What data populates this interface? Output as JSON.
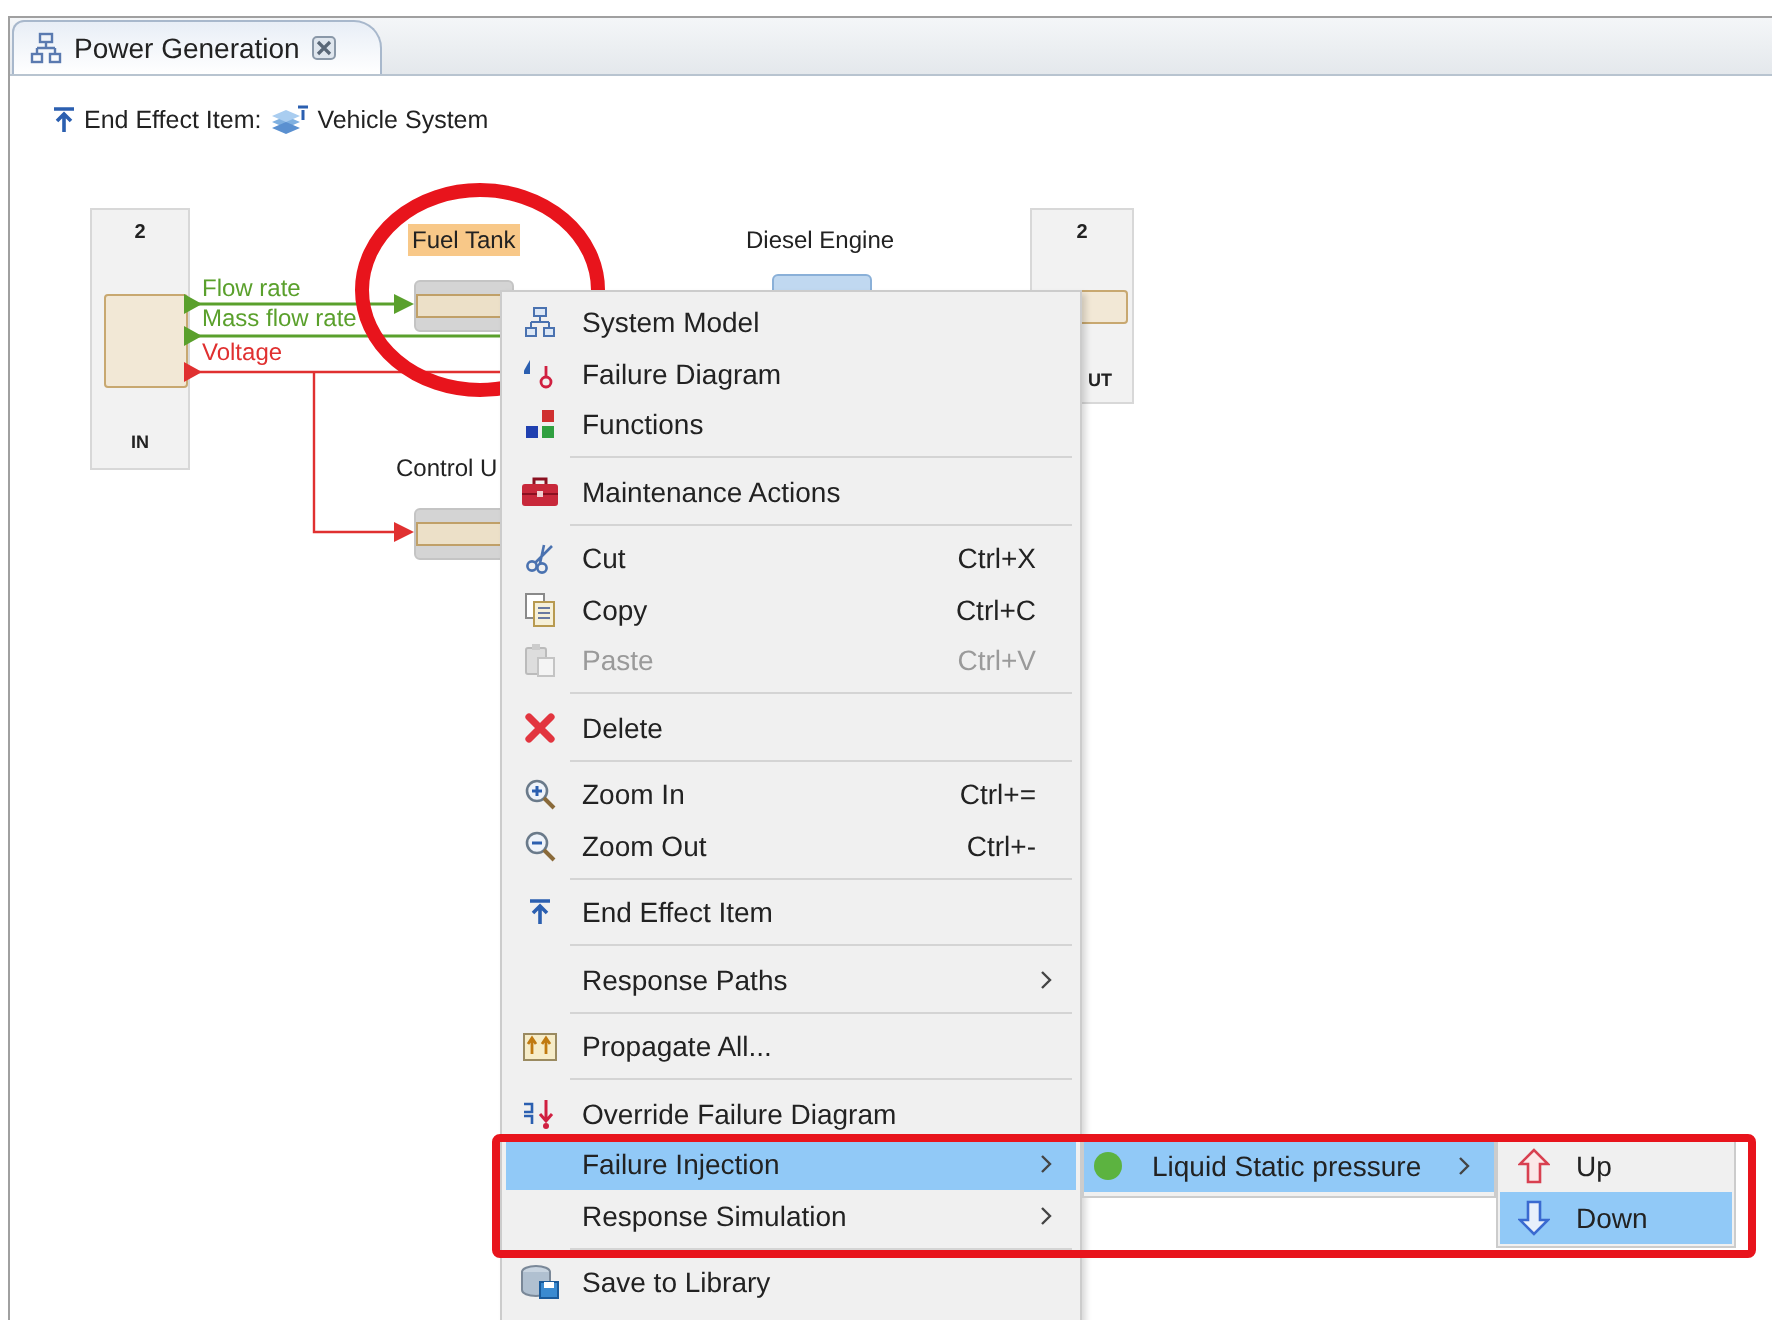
{
  "tab": {
    "title": "Power Generation"
  },
  "header": {
    "label": "End Effect Item:",
    "value": "Vehicle System"
  },
  "diagram": {
    "ports": [
      {
        "number": "2",
        "label": "IN"
      },
      {
        "number": "2",
        "label": "UT"
      }
    ],
    "components": [
      {
        "name": "Fuel Tank",
        "selected": true
      },
      {
        "name": "Diesel Engine",
        "selected": false
      },
      {
        "name": "Control U",
        "selected": false
      }
    ],
    "connections": [
      {
        "label": "Flow rate",
        "color": "#5aa02c"
      },
      {
        "label": "Mass flow rate",
        "color": "#5aa02c"
      },
      {
        "label": "Voltage",
        "color": "#e03030"
      }
    ]
  },
  "context_menu": {
    "items": [
      {
        "kind": "item",
        "label": "System Model",
        "disabled": false,
        "selected": false,
        "submenu": false
      },
      {
        "kind": "item",
        "label": "Failure Diagram",
        "disabled": false,
        "selected": false,
        "submenu": false
      },
      {
        "kind": "item",
        "label": "Functions",
        "disabled": false,
        "selected": false,
        "submenu": false
      },
      {
        "kind": "separator"
      },
      {
        "kind": "item",
        "label": "Maintenance Actions",
        "disabled": false,
        "selected": false,
        "submenu": false
      },
      {
        "kind": "separator"
      },
      {
        "kind": "item",
        "label": "Cut",
        "shortcut": "Ctrl+X",
        "disabled": false,
        "selected": false,
        "submenu": false
      },
      {
        "kind": "item",
        "label": "Copy",
        "shortcut": "Ctrl+C",
        "disabled": false,
        "selected": false,
        "submenu": false
      },
      {
        "kind": "item",
        "label": "Paste",
        "shortcut": "Ctrl+V",
        "disabled": true,
        "selected": false,
        "submenu": false
      },
      {
        "kind": "separator"
      },
      {
        "kind": "item",
        "label": "Delete",
        "disabled": false,
        "selected": false,
        "submenu": false
      },
      {
        "kind": "separator"
      },
      {
        "kind": "item",
        "label": "Zoom In",
        "shortcut": "Ctrl+=",
        "disabled": false,
        "selected": false,
        "submenu": false
      },
      {
        "kind": "item",
        "label": "Zoom Out",
        "shortcut": "Ctrl+-",
        "disabled": false,
        "selected": false,
        "submenu": false
      },
      {
        "kind": "separator"
      },
      {
        "kind": "item",
        "label": "End Effect Item",
        "disabled": false,
        "selected": false,
        "submenu": false
      },
      {
        "kind": "separator"
      },
      {
        "kind": "item",
        "label": "Response Paths",
        "disabled": false,
        "selected": false,
        "submenu": true
      },
      {
        "kind": "separator"
      },
      {
        "kind": "item",
        "label": "Propagate All...",
        "disabled": false,
        "selected": false,
        "submenu": false
      },
      {
        "kind": "separator"
      },
      {
        "kind": "item",
        "label": "Override Failure Diagram",
        "disabled": false,
        "selected": false,
        "submenu": false
      },
      {
        "kind": "item",
        "label": "Failure Injection",
        "disabled": false,
        "selected": true,
        "submenu": true
      },
      {
        "kind": "item",
        "label": "Response Simulation",
        "disabled": false,
        "selected": false,
        "submenu": true
      },
      {
        "kind": "separator"
      },
      {
        "kind": "item",
        "label": "Save to Library",
        "disabled": false,
        "selected": false,
        "submenu": false
      }
    ]
  },
  "failure_submenu": {
    "items": [
      {
        "label": "Liquid Static pressure",
        "color": "#5cb340",
        "selected": true,
        "submenu": true
      }
    ]
  },
  "direction_submenu": {
    "items": [
      {
        "label": "Up",
        "selected": false
      },
      {
        "label": "Down",
        "selected": true
      }
    ]
  }
}
